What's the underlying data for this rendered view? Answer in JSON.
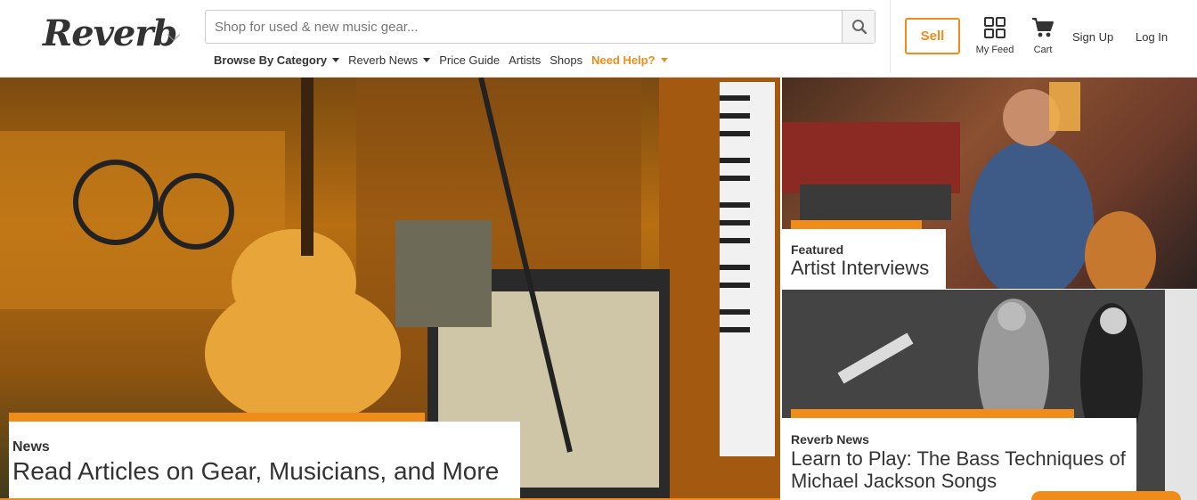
{
  "header": {
    "logo": "Reverb",
    "search": {
      "placeholder": "Shop for used & new music gear..."
    },
    "nav": [
      {
        "label": "Browse By Category",
        "bold": true,
        "dropdown": true
      },
      {
        "label": "Reverb News",
        "dropdown": true
      },
      {
        "label": "Price Guide"
      },
      {
        "label": "Artists"
      },
      {
        "label": "Shops"
      },
      {
        "label": "Need Help?",
        "dropdown": true,
        "highlight": true
      }
    ],
    "sell_label": "Sell",
    "my_feed_label": "My Feed",
    "cart_label": "Cart",
    "signup_label": "Sign Up",
    "login_label": "Log In"
  },
  "hero": {
    "main": {
      "kicker": "News",
      "headline": "Read Articles on Gear, Musicians, and More"
    },
    "top_right": {
      "kicker": "Featured",
      "headline": "Artist Interviews"
    },
    "bottom_right": {
      "kicker": "Reverb News",
      "headline": "Learn to Play: The Bass Techniques of Michael Jackson Songs"
    }
  },
  "colors": {
    "accent": "#f08c1a",
    "text": "#333333"
  }
}
